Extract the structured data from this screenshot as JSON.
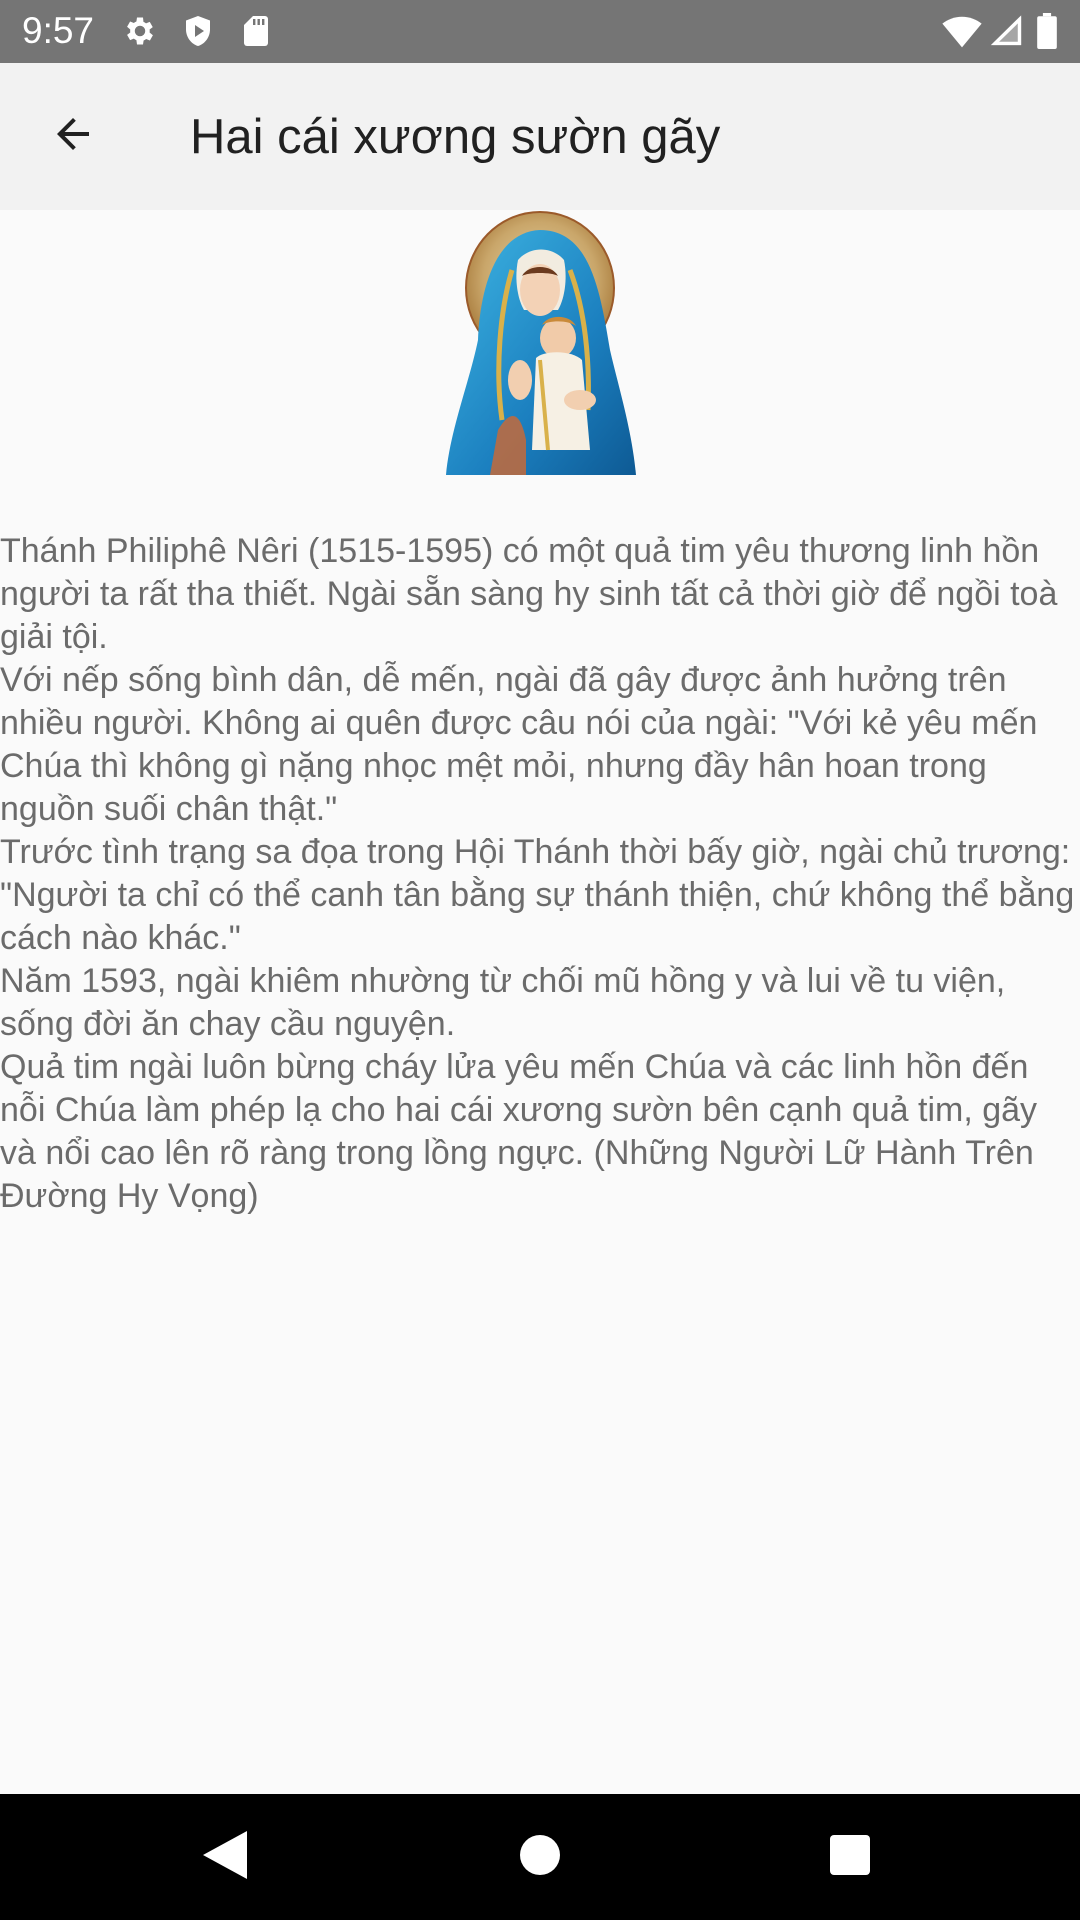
{
  "status_bar": {
    "time": "9:57",
    "left_icons": [
      "gear-icon",
      "shield-icon",
      "sd-card-icon"
    ],
    "right_icons": [
      "wifi-icon",
      "signal-icon",
      "battery-icon"
    ]
  },
  "app_bar": {
    "title": "Hai cái xương sườn gãy",
    "back_icon": "arrow-back-icon"
  },
  "image": {
    "description_icon": "madonna-child-image"
  },
  "article": {
    "paragraphs": [
      "Thánh Philiphê Nêri (1515-1595) có một quả tim yêu thương linh hồn người ta rất tha thiết. Ngài sẵn sàng hy sinh tất cả thời giờ để ngồi toà giải tội.",
      "Với nếp sống bình dân, dễ mến, ngài đã gây được ảnh hưởng trên nhiều người. Không ai quên được câu nói của ngài: \"Với kẻ yêu mến Chúa thì không gì nặng nhọc mệt mỏi, nhưng đầy hân hoan trong nguồn suối chân thật.\"",
      "Trước tình trạng sa đọa trong Hội Thánh thời bấy giờ, ngài chủ trương: \"Người ta chỉ có thể canh tân bằng sự thánh thiện, chứ không thể bằng cách nào khác.\"",
      "Năm 1593, ngài khiêm nhường từ chối mũ hồng y và lui về tu viện, sống đời ăn chay cầu nguyện.",
      "Quả tim ngài luôn bừng cháy lửa yêu mến Chúa và các linh hồn đến nỗi Chúa làm phép lạ cho hai cái xương sườn bên cạnh quả tim, gãy và nổi cao lên rõ ràng trong lồng ngực. (Những Người Lữ Hành Trên Đường Hy Vọng)"
    ]
  },
  "nav_bar": {
    "back": "nav-back-icon",
    "home": "nav-home-icon",
    "recents": "nav-recents-icon"
  },
  "colors": {
    "status_bar": "#757575",
    "app_bar": "#f2f2f2",
    "background": "#fafafa",
    "text": "#6b6b6b",
    "title": "#212121",
    "nav_bar": "#000000"
  }
}
